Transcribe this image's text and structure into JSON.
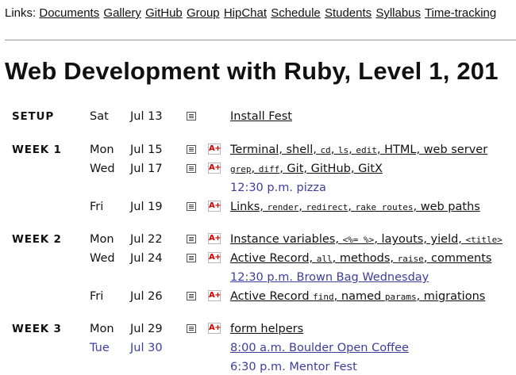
{
  "links": {
    "prefix": "Links:",
    "items": [
      "Documents",
      "Gallery",
      "GitHub",
      "Group",
      "HipChat",
      "Schedule",
      "Students",
      "Syllabus",
      "Time-tracking"
    ]
  },
  "title": "Web Development with Ruby, Level 1, 201",
  "icons": {
    "notes": "notes-icon",
    "grade": "assignment-icon",
    "grade_text": "A+"
  },
  "colors": {
    "event": "#3d3d9e",
    "grade": "#d40000",
    "text": "#111111"
  },
  "schedule": [
    {
      "week": "SETUP",
      "day": "Sat",
      "date": "Jul 13",
      "notes": true,
      "assignment": false,
      "topic": [
        {
          "t": "Install Fest"
        }
      ]
    },
    {
      "week": "WEEK 1",
      "day": "Mon",
      "date": "Jul 15",
      "notes": true,
      "assignment": true,
      "topic": [
        {
          "t": "Terminal, shell, "
        },
        {
          "c": "cd"
        },
        {
          "t": ", "
        },
        {
          "c": "ls"
        },
        {
          "t": ", "
        },
        {
          "c": "edit"
        },
        {
          "t": ", HTML, web server"
        }
      ]
    },
    {
      "week": "",
      "day": "Wed",
      "date": "Jul 17",
      "notes": true,
      "assignment": true,
      "topic": [
        {
          "c": "grep"
        },
        {
          "t": ", "
        },
        {
          "c": "diff"
        },
        {
          "t": ", Git, GitHub, GitX"
        }
      ]
    },
    {
      "event": true,
      "link": false,
      "text": "12:30 p.m. pizza"
    },
    {
      "week": "",
      "day": "Fri",
      "date": "Jul 19",
      "notes": true,
      "assignment": true,
      "topic": [
        {
          "t": "Links, "
        },
        {
          "c": "render"
        },
        {
          "t": ", "
        },
        {
          "c": "redirect"
        },
        {
          "t": ", "
        },
        {
          "c": "rake routes"
        },
        {
          "t": ", web paths"
        }
      ]
    },
    {
      "week": "WEEK 2",
      "day": "Mon",
      "date": "Jul 22",
      "notes": true,
      "assignment": true,
      "topic": [
        {
          "t": "Instance variables, "
        },
        {
          "c": "<%= %>"
        },
        {
          "t": ", layouts, yield, "
        },
        {
          "c": "<title>"
        }
      ]
    },
    {
      "week": "",
      "day": "Wed",
      "date": "Jul 24",
      "notes": true,
      "assignment": true,
      "topic": [
        {
          "t": "Active Record, "
        },
        {
          "c": "all"
        },
        {
          "t": ", methods, "
        },
        {
          "c": "raise"
        },
        {
          "t": ", comments"
        }
      ]
    },
    {
      "event": true,
      "link": true,
      "text": "12:30 p.m. Brown Bag Wednesday"
    },
    {
      "week": "",
      "day": "Fri",
      "date": "Jul 26",
      "notes": true,
      "assignment": true,
      "topic": [
        {
          "t": "Active Record "
        },
        {
          "c": "find"
        },
        {
          "t": ", named "
        },
        {
          "c": "params"
        },
        {
          "t": ", migrations"
        }
      ]
    },
    {
      "week": "WEEK 3",
      "day": "Mon",
      "date": "Jul 29",
      "notes": true,
      "assignment": true,
      "topic": [
        {
          "t": "form helpers"
        }
      ]
    },
    {
      "event": true,
      "link": true,
      "day": "Tue",
      "date": "Jul 30",
      "text": "8:00 a.m. Boulder Open Coffee"
    },
    {
      "event": true,
      "link": false,
      "text": "6:30 p.m. Mentor Fest"
    }
  ]
}
